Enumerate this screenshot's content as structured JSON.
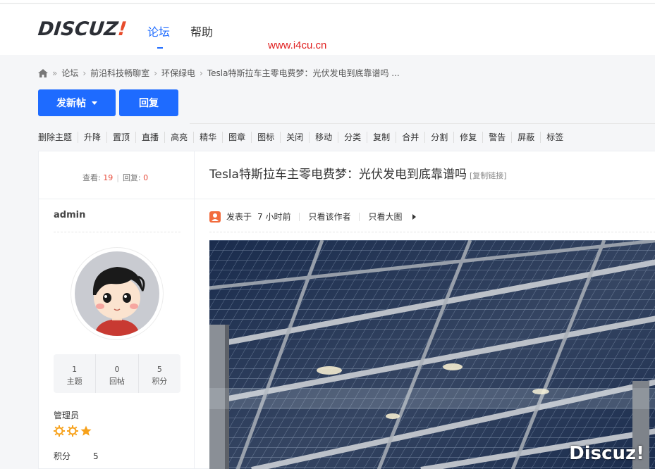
{
  "header": {
    "logo_text": "DISCUZ",
    "logo_mark": "!",
    "nav": [
      {
        "label": "论坛",
        "active": true
      },
      {
        "label": "帮助",
        "active": false
      }
    ],
    "watermark_url": "www.i4cu.cn"
  },
  "breadcrumb": {
    "home_icon": "home-icon",
    "separator": "»",
    "items": [
      "论坛",
      "前沿科技畅聊室",
      "环保绿电",
      "Tesla特斯拉车主零电费梦：光伏发电到底靠谱吗 ..."
    ],
    "chevron": "›"
  },
  "buttons": {
    "new_thread": "发新帖",
    "reply": "回复"
  },
  "mod_toolbar": [
    "删除主题",
    "升降",
    "置顶",
    "直播",
    "高亮",
    "精华",
    "图章",
    "图标",
    "关闭",
    "移动",
    "分类",
    "复制",
    "合并",
    "分割",
    "修复",
    "警告",
    "屏蔽",
    "标签"
  ],
  "thread": {
    "views_label": "查看:",
    "views": "19",
    "replies_label": "回复:",
    "replies": "0",
    "title": "Tesla特斯拉车主零电费梦：光伏发电到底靠谱吗",
    "copy_link": "[复制链接]"
  },
  "author": {
    "name": "admin",
    "stats": [
      {
        "value": "1",
        "label": "主题"
      },
      {
        "value": "0",
        "label": "回帖"
      },
      {
        "value": "5",
        "label": "积分"
      }
    ],
    "role": "管理员",
    "stars": [
      "sun-icon",
      "sun-icon",
      "star-icon"
    ],
    "score_label": "积分",
    "score": "5"
  },
  "post": {
    "posted_label": "发表于",
    "posted_time": "7 小时前",
    "author_only": "只看该作者",
    "large_image": "只看大图",
    "image_watermark": "Discuz!"
  },
  "colors": {
    "accent": "#1e6bff",
    "watermark_red": "#e02020",
    "star_orange": "#f7a11a",
    "count_red": "#e74c3c"
  }
}
